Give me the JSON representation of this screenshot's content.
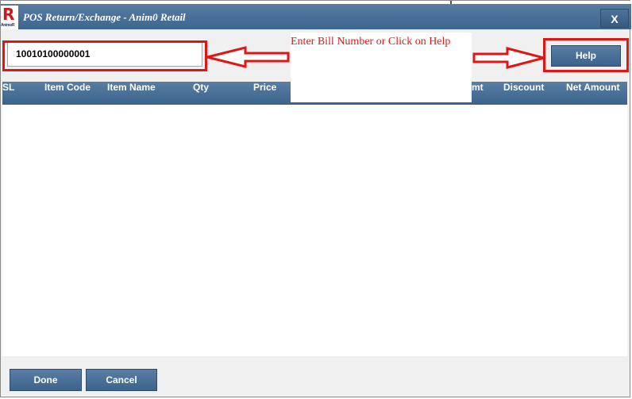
{
  "window": {
    "title": "POS Return/Exchange - Anim0 Retail",
    "close_label": "X",
    "logo_letter": "R",
    "logo_text": "AnimoR"
  },
  "bill": {
    "value": "10010100000001"
  },
  "help_button": "Help",
  "annotation": {
    "text": "Enter Bill Number or Click on Help",
    "color": "#e01616"
  },
  "grid": {
    "columns": [
      "SL",
      "Item Code",
      "Item Name",
      "Qty",
      "Price",
      "mt",
      "Discount",
      "Net Amount"
    ],
    "rows": []
  },
  "footer": {
    "done_label": "Done",
    "cancel_label": "Cancel"
  },
  "colors": {
    "accent": "#3e6690",
    "highlight": "#e01616"
  }
}
